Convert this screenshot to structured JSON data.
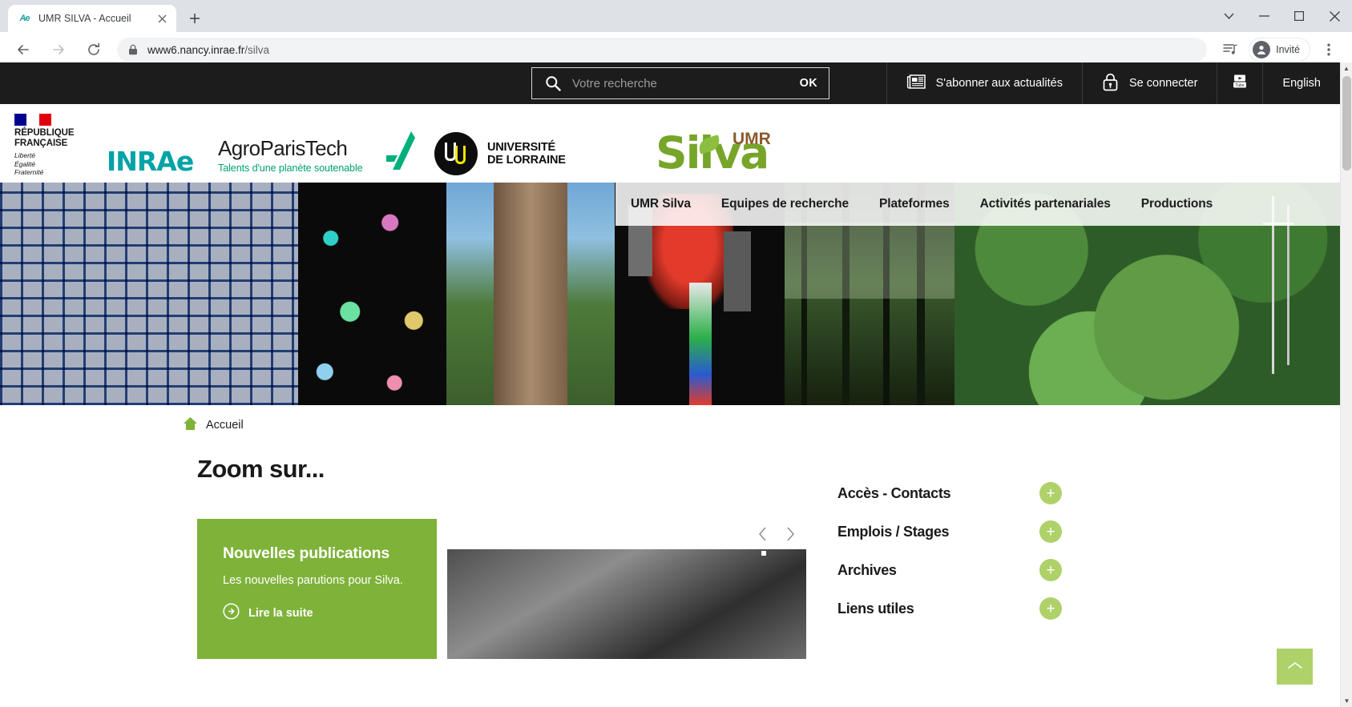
{
  "browser": {
    "tab": {
      "title": "UMR SILVA - Accueil",
      "favicon_icon": "inrae-favicon",
      "close_icon": "close-icon"
    },
    "newtab_icon": "plus-icon",
    "window": {
      "minimize_icon": "minimize-icon",
      "maximize_icon": "maximize-icon",
      "close_icon": "close-icon",
      "taglist_icon": "chevron-down-icon"
    },
    "toolbar": {
      "back_icon": "back-arrow-icon",
      "forward_icon": "forward-arrow-icon",
      "reload_icon": "reload-icon",
      "lock_icon": "lock-icon",
      "url_host": "www6.nancy.inrae.fr",
      "url_path": "/silva",
      "readinglist_icon": "reading-list-icon",
      "profile_label": "Invité",
      "profile_icon": "user-avatar-icon",
      "menu_icon": "three-dot-menu-icon"
    }
  },
  "utilbar": {
    "search": {
      "placeholder": "Votre recherche",
      "value": "",
      "icon": "search-icon",
      "submit_label": "OK"
    },
    "links": [
      {
        "label": "S'abonner aux actualités",
        "icon": "newspaper-icon"
      },
      {
        "label": "Se connecter",
        "icon": "lock-icon"
      },
      {
        "label": "",
        "icon": "youtube-icon"
      },
      {
        "label": "English",
        "icon": ""
      }
    ]
  },
  "logos": {
    "republique": {
      "line1": "RÉPUBLIQUE",
      "line2": "FRANÇAISE",
      "motto1": "Liberté",
      "motto2": "Égalité",
      "motto3": "Fraternité"
    },
    "inrae": "INRAe",
    "agroparistech": {
      "name": "AgroParisTech",
      "tagline": "Talents d'une planète soutenable"
    },
    "universite": {
      "line1": "UNIVERSITÉ",
      "line2": "DE LORRAINE"
    },
    "silva": {
      "word": "Silva",
      "badge": "UMR"
    }
  },
  "nav": {
    "items": [
      {
        "label": "UMR Silva"
      },
      {
        "label": "Equipes de recherche"
      },
      {
        "label": "Plateformes"
      },
      {
        "label": "Activités partenariales"
      },
      {
        "label": "Productions"
      }
    ]
  },
  "breadcrumb": {
    "home_icon": "home-icon",
    "label": "Accueil"
  },
  "main": {
    "title": "Zoom sur...",
    "card": {
      "heading": "Nouvelles publications",
      "text": "Les nouvelles parutions pour Silva.",
      "link_label": "Lire la suite",
      "link_icon": "arrow-right-circle-icon"
    },
    "slider": {
      "prev_icon": "chevron-left-icon",
      "next_icon": "chevron-right-icon"
    }
  },
  "sidebar": {
    "items": [
      {
        "label": "Accès - Contacts",
        "toggle_icon": "plus-icon"
      },
      {
        "label": "Emplois / Stages",
        "toggle_icon": "plus-icon"
      },
      {
        "label": "Archives",
        "toggle_icon": "plus-icon"
      },
      {
        "label": "Liens utiles",
        "toggle_icon": "plus-icon"
      }
    ]
  },
  "scroll_top": {
    "icon": "chevron-up-icon"
  },
  "colors": {
    "brand_green": "#7FB239",
    "accent_light_green": "#AFD169",
    "inrae_teal": "#00A3A6",
    "agroparistech_green": "#00A171",
    "silva_green": "#76A52A",
    "silva_brown": "#8A5A2B",
    "utilbar_dark": "#1c1c1c"
  }
}
